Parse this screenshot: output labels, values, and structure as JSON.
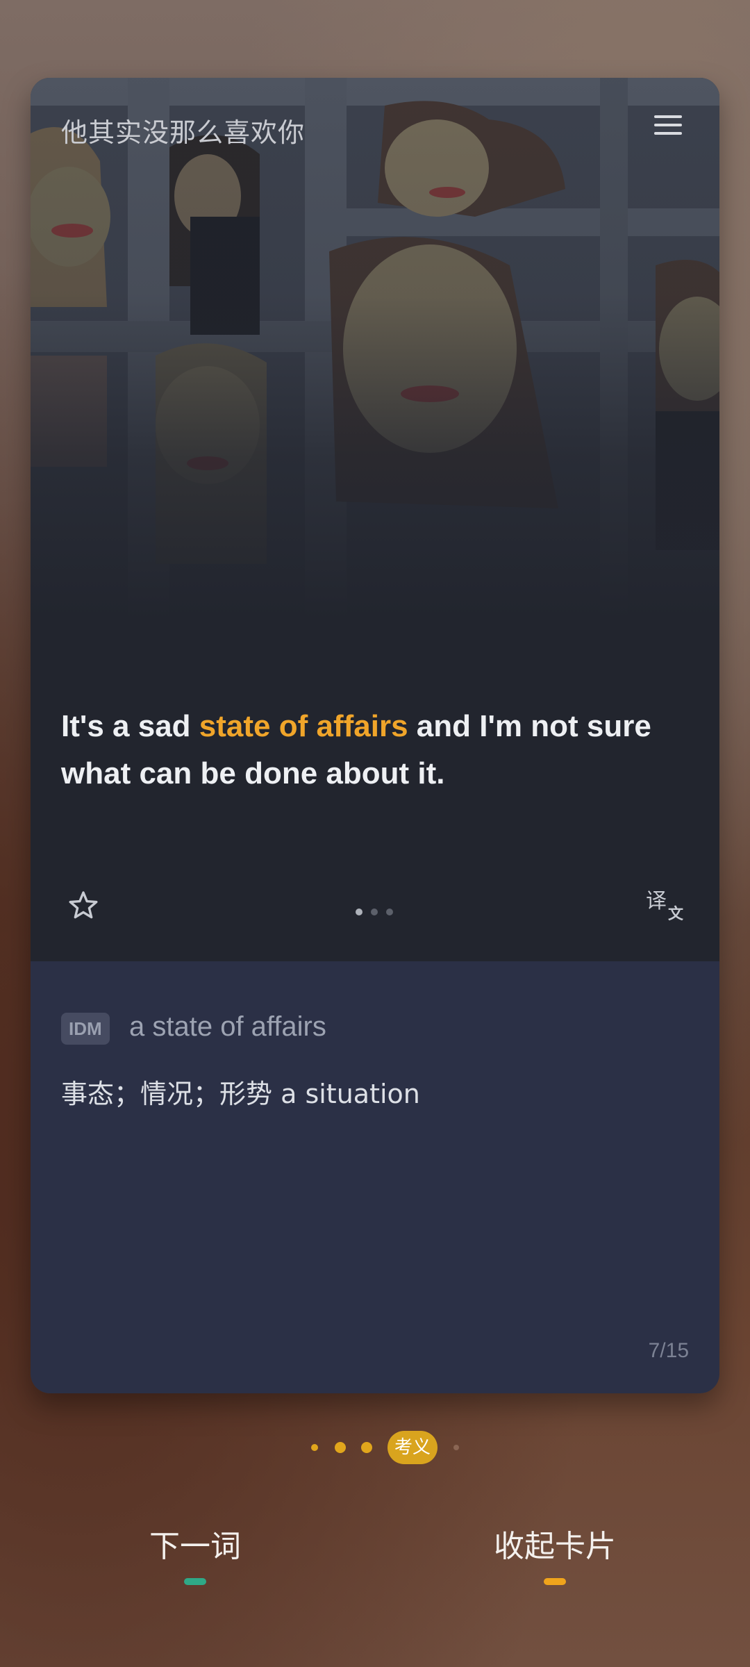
{
  "card": {
    "title": "他其实没那么喜欢你",
    "sentence": {
      "before": "It's a sad ",
      "highlight": "state of affairs",
      "after": " and I'm not sure what can be done about it."
    },
    "pager": {
      "total": 3,
      "active": 0
    },
    "definition": {
      "tag": "IDM",
      "phrase": "a state of affairs",
      "meaning": "事态；情况；形势  a situation"
    },
    "counter": "7/15"
  },
  "steps": {
    "badge": "考义"
  },
  "actions": {
    "next": "下一词",
    "collapse": "收起卡片"
  },
  "colors": {
    "highlight": "#f0a52a",
    "next_indicator": "#2fa987",
    "collapse_indicator": "#f0a41c",
    "step_badge": "#d9a41e"
  }
}
